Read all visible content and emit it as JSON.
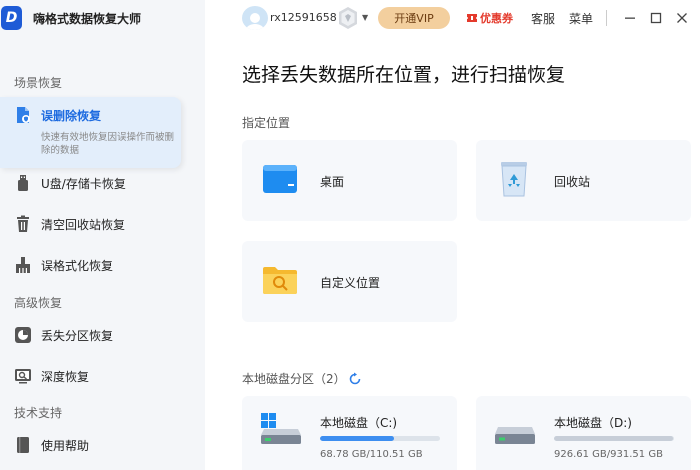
{
  "app": {
    "title": "嗨格式数据恢复大师",
    "logo_letter": "D"
  },
  "sidebar": {
    "sections": [
      {
        "title": "场景恢复"
      },
      {
        "title": "高级恢复"
      },
      {
        "title": "技术支持"
      }
    ],
    "items": [
      {
        "label": "误删除恢复",
        "description": "快速有效地恢复因误操作而被删除的数据",
        "icon": "file-shield-icon",
        "active": true
      },
      {
        "label": "U盘/存储卡恢复",
        "icon": "usb-icon"
      },
      {
        "label": "清空回收站恢复",
        "icon": "trash-icon"
      },
      {
        "label": "误格式化恢复",
        "icon": "format-icon"
      },
      {
        "label": "丢失分区恢复",
        "icon": "partition-icon"
      },
      {
        "label": "深度恢复",
        "icon": "deep-scan-icon"
      },
      {
        "label": "使用帮助",
        "icon": "help-book-icon"
      }
    ]
  },
  "topbar": {
    "username": "rx12591658",
    "vip_label": "开通VIP",
    "coupon_label": "优惠券",
    "service_label": "客服",
    "menu_label": "菜单"
  },
  "main": {
    "title": "选择丢失数据所在位置，进行扫描恢复",
    "locations_label": "指定位置",
    "locations": [
      {
        "label": "桌面",
        "icon": "desktop-icon"
      },
      {
        "label": "回收站",
        "icon": "recycle-bin-icon"
      },
      {
        "label": "自定义位置",
        "icon": "folder-search-icon"
      }
    ],
    "disks_label": "本地磁盘分区",
    "disks_count": "（2）",
    "disks": [
      {
        "name": "本地磁盘（C:)",
        "used_fraction": 0.62,
        "size_text": "68.78 GB/110.51 GB",
        "system": true
      },
      {
        "name": "本地磁盘（D:)",
        "used_fraction": 0.99,
        "size_text": "926.61 GB/931.51 GB",
        "system": false
      }
    ]
  },
  "colors": {
    "accent": "#1e6be0",
    "vip": "#f3cf9e",
    "coupon": "#e43a2c"
  }
}
